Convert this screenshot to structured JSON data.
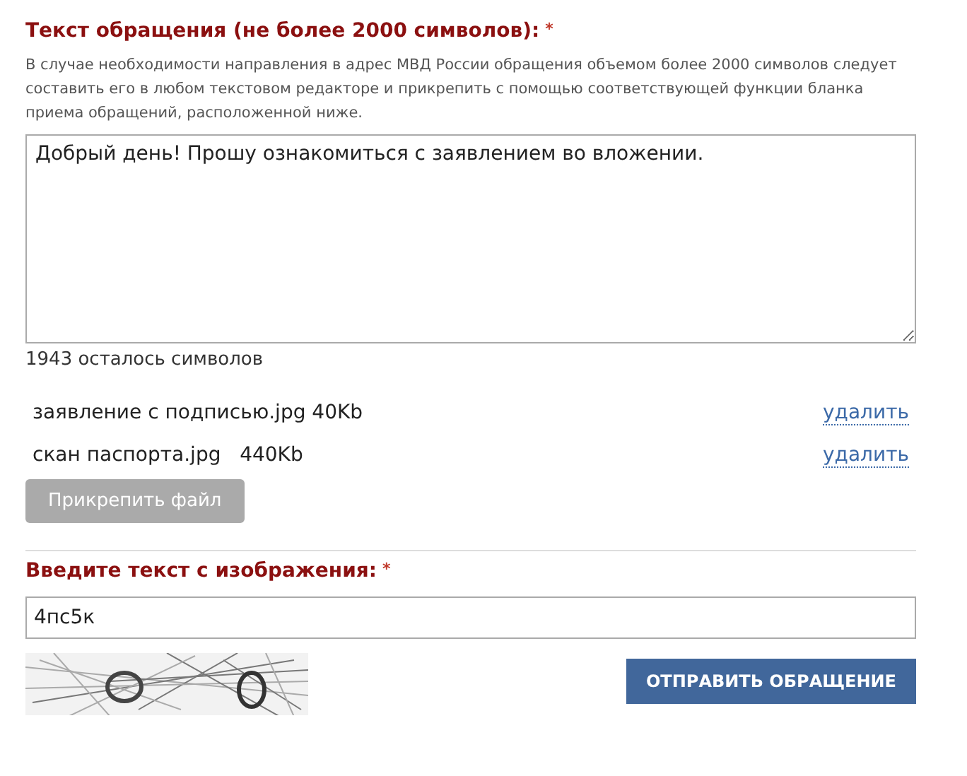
{
  "message": {
    "label": "Текст обращения (не более 2000 символов):",
    "required_mark": "*",
    "hint": "В случае необходимости направления в адрес МВД России обращения объемом более 2000 символов следует составить его в любом текстовом редакторе и прикрепить с помощью соответствующей функции бланка приема обращений, расположенной ниже.",
    "value": "Добрый день! Прошу ознакомиться с заявлением во вложении.",
    "remaining": "1943 осталось символов"
  },
  "attachments": [
    {
      "name": "заявление с подписью.jpg 40Kb",
      "action": "удалить"
    },
    {
      "name": "скан паспорта.jpg   440Kb",
      "action": "удалить"
    }
  ],
  "attach_button": "Прикрепить файл",
  "captcha": {
    "label": "Введите текст с изображения:",
    "required_mark": "*",
    "value": "4пс5к"
  },
  "submit_button": "ОТПРАВИТЬ ОБРАЩЕНИЕ"
}
